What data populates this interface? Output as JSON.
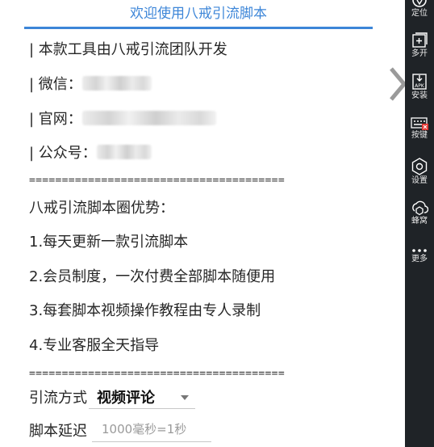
{
  "header": {
    "title": "欢迎使用八戒引流脚本"
  },
  "info": {
    "intro": "| 本款工具由八戒引流团队开发",
    "wechat_label": "| 微信：",
    "website_label": "| 官网：",
    "official_account_label": "| 公众号："
  },
  "separator": "=======================================",
  "benefits": {
    "heading": "八戒引流脚本圈优势：",
    "items": [
      "1.每天更新一款引流脚本",
      "2.会员制度，一次付费全部脚本随便用",
      "3.每套脚本视频操作教程由专人录制",
      "4.专业客服全天指导"
    ]
  },
  "form": {
    "mode_label": "引流方式",
    "mode_value": "视频评论",
    "delay_label": "脚本延迟",
    "delay_placeholder": "1000毫秒=1秒"
  },
  "sidebar": {
    "items": [
      {
        "label": "定位",
        "icon": "location-icon"
      },
      {
        "label": "多开",
        "icon": "multi-open-icon"
      },
      {
        "label": "安装",
        "icon": "apk-install-icon"
      },
      {
        "label": "按键",
        "icon": "keyboard-icon"
      },
      {
        "label": "设置",
        "icon": "settings-icon"
      },
      {
        "label": "蜂窝",
        "icon": "cellular-icon"
      },
      {
        "label": "更多",
        "icon": "more-icon"
      }
    ]
  },
  "colors": {
    "accent": "#3d86d8",
    "sidebar_bg": "#1f2327",
    "keyboard_badge": "#e53935"
  }
}
